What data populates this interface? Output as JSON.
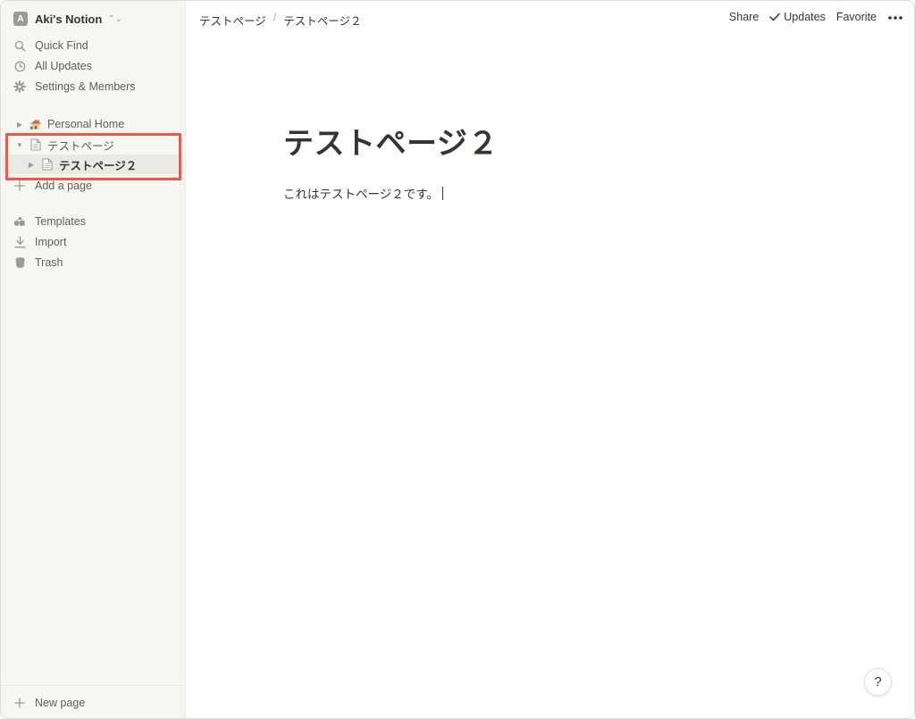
{
  "workspace": {
    "avatar_letter": "A",
    "name": "Aki's Notion"
  },
  "sidebar": {
    "nav": [
      {
        "label": "Quick Find",
        "icon": "search-icon"
      },
      {
        "label": "All Updates",
        "icon": "clock-icon"
      },
      {
        "label": "Settings & Members",
        "icon": "gear-icon"
      }
    ],
    "tree": [
      {
        "label": "Personal Home",
        "icon": "house-emoji",
        "expanded": false
      },
      {
        "label": "テストページ",
        "icon": "page-icon",
        "expanded": true
      },
      {
        "label": "テストページ２",
        "icon": "page-icon",
        "expanded": false,
        "active": true
      }
    ],
    "add_page": "Add a page",
    "tools": [
      {
        "label": "Templates",
        "icon": "templates-icon"
      },
      {
        "label": "Import",
        "icon": "import-icon"
      },
      {
        "label": "Trash",
        "icon": "trash-icon"
      }
    ],
    "new_page": "New page"
  },
  "topbar": {
    "breadcrumb": [
      "テストページ",
      "テストページ２"
    ],
    "separator": "/",
    "share": "Share",
    "updates": "Updates",
    "favorite": "Favorite"
  },
  "page": {
    "title": "テストページ２",
    "body": "これはテストページ２です。"
  },
  "help": "?",
  "colors": {
    "highlight": "#f0564a",
    "sidebar_bg": "#f7f6f3",
    "text": "#37352f"
  }
}
